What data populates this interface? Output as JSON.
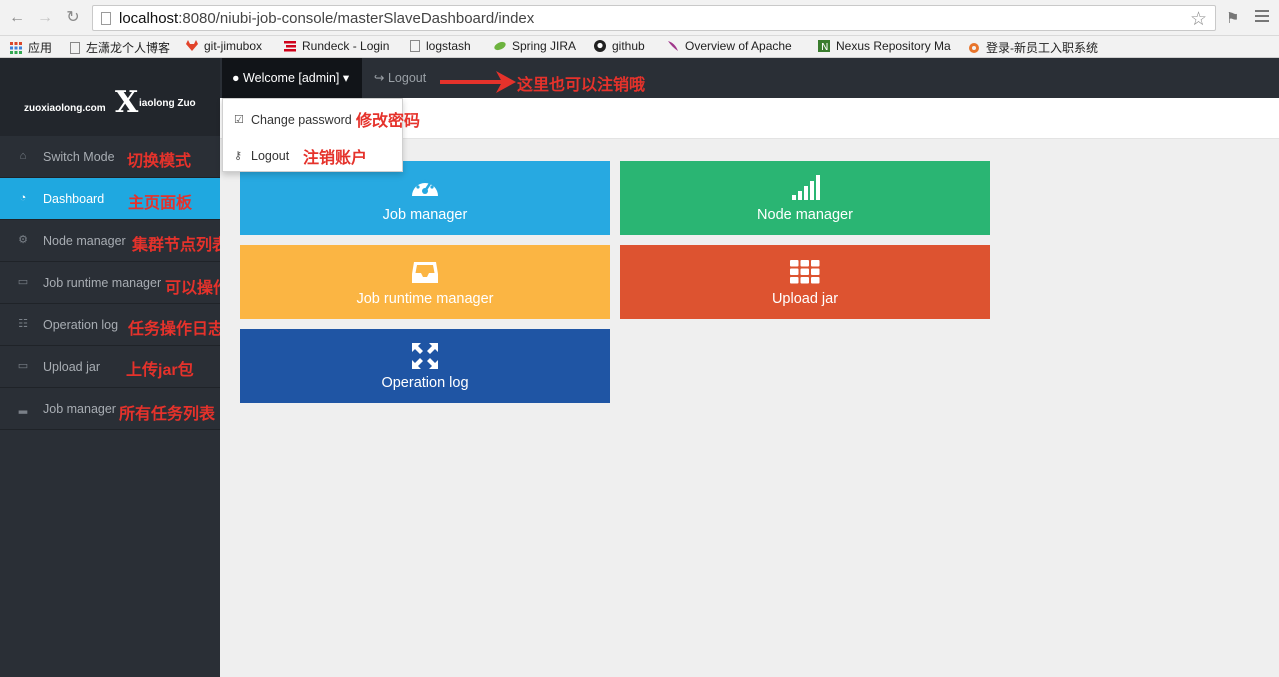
{
  "browser": {
    "url_host": "localhost",
    "url_rest": ":8080/niubi-job-console/masterSlaveDashboard/index",
    "bookmarks": [
      {
        "label": "应用",
        "color": "#d9472b"
      },
      {
        "label": "左潇龙个人博客",
        "color": "#888888"
      },
      {
        "label": "git-jimubox",
        "color": "#e2432a"
      },
      {
        "label": "Rundeck - Login",
        "color": "#d0021b"
      },
      {
        "label": "logstash",
        "color": "#888888"
      },
      {
        "label": "Spring JIRA",
        "color": "#6db33f"
      },
      {
        "label": "github",
        "color": "#222222"
      },
      {
        "label": "Overview of Apache",
        "color": "#a0378b"
      },
      {
        "label": "Nexus Repository Ma",
        "color": "#3a7d2e"
      },
      {
        "label": "登录-新员工入职系统",
        "color": "#e8742b"
      }
    ]
  },
  "logo": {
    "site": "zuoxiaolong.com",
    "mark": "X",
    "name": "iaolong Zuo"
  },
  "header": {
    "welcome": "Welcome [admin]",
    "logout": "Logout",
    "logout_annotation": "这里也可以注销哦"
  },
  "dropdown": {
    "items": [
      {
        "label": "Change password",
        "annotation": "修改密码"
      },
      {
        "label": "Logout",
        "annotation": "注销账户"
      }
    ]
  },
  "sidebar": {
    "items": [
      {
        "label": "Switch Mode",
        "annotation": "切换模式",
        "icon": "home-icon"
      },
      {
        "label": "Dashboard",
        "annotation": "主页面板",
        "icon": "dashboard-icon",
        "active": true
      },
      {
        "label": "Node manager",
        "annotation": "集群节点列表",
        "icon": "gear-icon"
      },
      {
        "label": "Job runtime manager",
        "annotation": "可以操作的任务列表",
        "icon": "inbox-icon"
      },
      {
        "label": "Operation log",
        "annotation": "任务操作日志",
        "icon": "grid-icon"
      },
      {
        "label": "Upload jar",
        "annotation": "上传jar包",
        "icon": "inbox-icon"
      },
      {
        "label": "Job manager",
        "annotation": "所有任务列表",
        "icon": "signal-icon"
      }
    ]
  },
  "tiles": [
    {
      "label": "Job manager",
      "color": "#27a9e1",
      "icon": "dashboard-icon"
    },
    {
      "label": "Node manager",
      "color": "#2ab573",
      "icon": "signal-icon"
    },
    {
      "label": "Job runtime manager",
      "color": "#fbb543",
      "icon": "inbox-icon"
    },
    {
      "label": "Upload jar",
      "color": "#dd5330",
      "icon": "grid-icon"
    },
    {
      "label": "Operation log",
      "color": "#1f55a4",
      "icon": "expand-icon"
    }
  ],
  "colors": {
    "annotation": "#e5322b",
    "sidebar": "#2a2f36",
    "active": "#1fa8e0"
  }
}
